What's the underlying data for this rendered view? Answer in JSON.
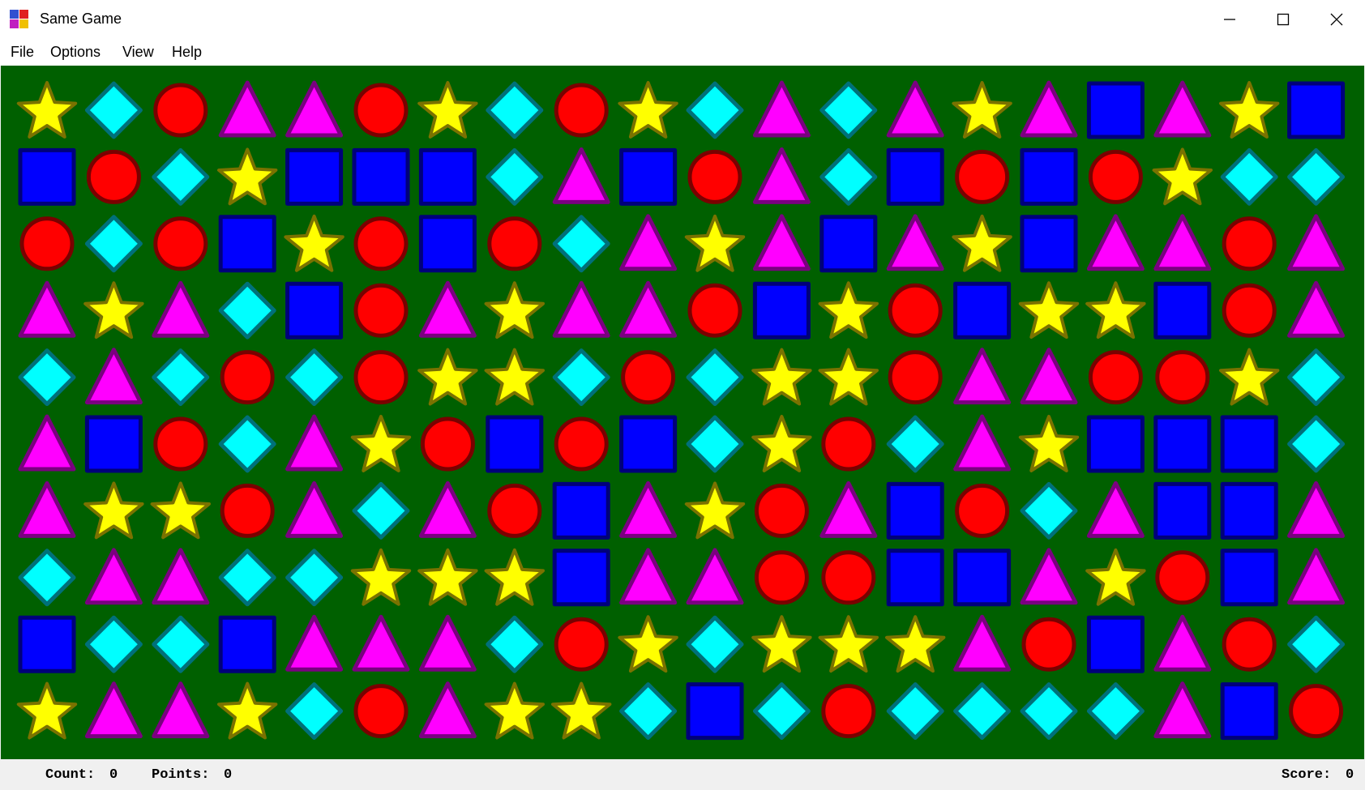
{
  "window": {
    "title": "Same Game"
  },
  "menu": [
    "File",
    "Options",
    "View",
    "Help"
  ],
  "status": {
    "count_label": "Count:",
    "count": "0",
    "points_label": "Points:",
    "points": "0",
    "score_label": "Score:",
    "score": "0"
  },
  "board": {
    "background": "#006000",
    "columns": 20,
    "rows": 10,
    "legend": {
      "S": "star",
      "D": "diamond",
      "C": "circle",
      "T": "triangle",
      "Q": "square"
    },
    "cells": [
      "SDCTTCSDCSDTDTSTQTSQ",
      "QCDSQQQDTQCTDQCQCSDD",
      "CDCQSCQCDTSTQTSQTTCT",
      "TSTDQCTSTTCQSCQSSQCT",
      "DTDCDCSSDCDSSCTTCCSD",
      "TQCDTSCQCQDSCDTSQQQD",
      "TSSCTDTCQTSCTQCDTQQT",
      "DTTDDSSSQTTCCQQTSCQT",
      "QDDQTTTDCSDSSSTCQTCD",
      "STTSDCTSSDQDCDDDDTQC"
    ],
    "colors": {
      "star": {
        "fill": "#ffff00",
        "stroke": "#7a7200"
      },
      "diamond": {
        "fill": "#00ffff",
        "stroke": "#00707a"
      },
      "circle": {
        "fill": "#ff0000",
        "stroke": "#7a0000"
      },
      "triangle": {
        "fill": "#ff00ff",
        "stroke": "#7a0080"
      },
      "square": {
        "fill": "#0000ff",
        "stroke": "#00007a"
      }
    }
  }
}
